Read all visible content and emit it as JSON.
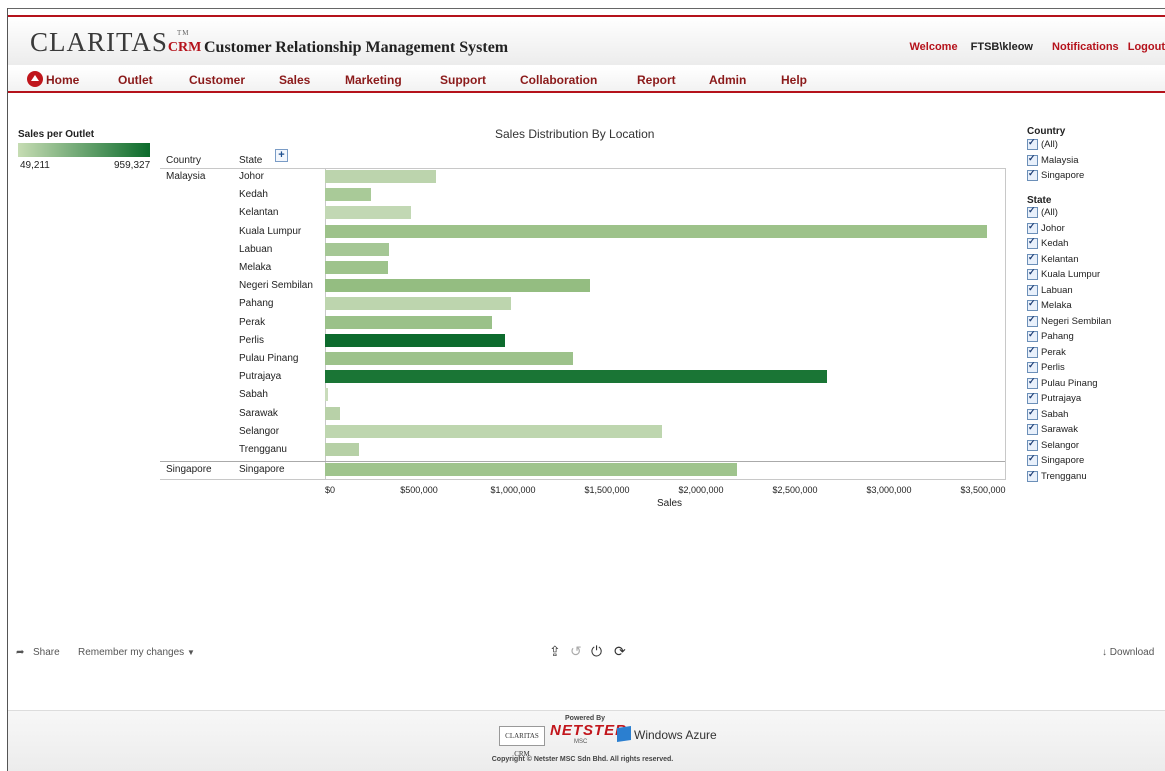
{
  "header": {
    "logo_text": "CLARITAS",
    "logo_sub": "CRM",
    "logo_tm": "TM",
    "system_title": "Customer Relationship Management System",
    "welcome": "Welcome",
    "username": "FTSB\\kleow",
    "notifications": "Notifications",
    "logout": "Logout"
  },
  "nav": {
    "items": [
      "Home",
      "Outlet",
      "Customer",
      "Sales",
      "Marketing",
      "Support",
      "Collaboration",
      "Report",
      "Admin",
      "Help"
    ]
  },
  "legend": {
    "title": "Sales per Outlet",
    "min": "49,211",
    "max": "959,327",
    "color_min": "#c6dcb3",
    "color_max": "#0b6b2b"
  },
  "chart_data": {
    "type": "bar",
    "title": "Sales Distribution By Location",
    "xlabel": "Sales",
    "column_headers": [
      "Country",
      "State"
    ],
    "x_ticks": [
      "$0",
      "$500,000",
      "$1,000,000",
      "$1,500,000",
      "$2,000,000",
      "$2,500,000",
      "$3,000,000",
      "$3,500,000"
    ],
    "xlim": [
      0,
      3600000
    ],
    "rows": [
      {
        "country": "Malaysia",
        "state": "Johor",
        "value": 590000,
        "color": "#bcd4ad"
      },
      {
        "country": "",
        "state": "Kedah",
        "value": 245000,
        "color": "#a9ca98"
      },
      {
        "country": "",
        "state": "Kelantan",
        "value": 460000,
        "color": "#c2d8b4"
      },
      {
        "country": "",
        "state": "Kuala Lumpur",
        "value": 3520000,
        "color": "#9dc28a"
      },
      {
        "country": "",
        "state": "Labuan",
        "value": 340000,
        "color": "#a5c795"
      },
      {
        "country": "",
        "state": "Melaka",
        "value": 335000,
        "color": "#9ec38c"
      },
      {
        "country": "",
        "state": "Negeri Sembilan",
        "value": 1410000,
        "color": "#94bd81"
      },
      {
        "country": "",
        "state": "Pahang",
        "value": 990000,
        "color": "#bdd5ae"
      },
      {
        "country": "",
        "state": "Perak",
        "value": 890000,
        "color": "#9ac189"
      },
      {
        "country": "",
        "state": "Perlis",
        "value": 955000,
        "color": "#0d6b2d"
      },
      {
        "country": "",
        "state": "Pulau Pinang",
        "value": 1320000,
        "color": "#9dc28b"
      },
      {
        "country": "",
        "state": "Putrajaya",
        "value": 2670000,
        "color": "#1a7535"
      },
      {
        "country": "",
        "state": "Sabah",
        "value": 14000,
        "color": "#c9dcbb"
      },
      {
        "country": "",
        "state": "Sarawak",
        "value": 80000,
        "color": "#b8d1a8"
      },
      {
        "country": "",
        "state": "Selangor",
        "value": 1790000,
        "color": "#bed6af"
      },
      {
        "country": "",
        "state": "Trengganu",
        "value": 180000,
        "color": "#b6d0a6"
      },
      {
        "country": "Singapore",
        "state": "Singapore",
        "value": 2190000,
        "color": "#9fc48d"
      }
    ]
  },
  "filters": {
    "country_title": "Country",
    "country_items": [
      "(All)",
      "Malaysia",
      "Singapore"
    ],
    "state_title": "State",
    "state_items": [
      "(All)",
      "Johor",
      "Kedah",
      "Kelantan",
      "Kuala Lumpur",
      "Labuan",
      "Melaka",
      "Negeri Sembilan",
      "Pahang",
      "Perak",
      "Perlis",
      "Pulau Pinang",
      "Putrajaya",
      "Sabah",
      "Sarawak",
      "Selangor",
      "Singapore",
      "Trengganu"
    ]
  },
  "toolbar": {
    "share": "Share",
    "remember": "Remember my changes",
    "download": "Download",
    "icons": [
      "export-icon",
      "undo-icon",
      "revert-icon",
      "refresh-icon"
    ]
  },
  "footer": {
    "powered_by": "Powered By",
    "claritas": "CLARITAS CRM",
    "netster": "NETSTER",
    "msc": "MSC",
    "azure": "Windows Azure",
    "copyright": "Copyright © Netster MSC Sdn Bhd. All rights reserved."
  }
}
